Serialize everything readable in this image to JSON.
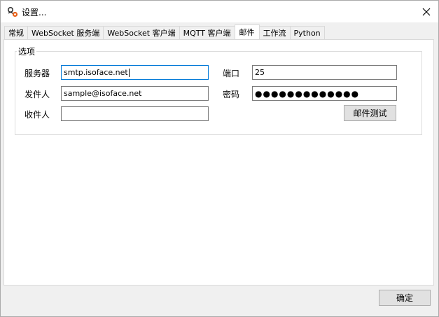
{
  "window": {
    "title": "设置..."
  },
  "tabs": [
    {
      "label": "常规"
    },
    {
      "label": "WebSocket 服务端"
    },
    {
      "label": "WebSocket 客户端"
    },
    {
      "label": "MQTT 客户端"
    },
    {
      "label": "邮件",
      "active": true
    },
    {
      "label": "工作流"
    },
    {
      "label": "Python"
    }
  ],
  "options": {
    "legend": "选项",
    "server_label": "服务器",
    "server_value": "smtp.isoface.net",
    "port_label": "端口",
    "port_value": "25",
    "sender_label": "发件人",
    "sender_value": "sample@isoface.net",
    "password_label": "密码",
    "password_mask": "●●●●●●●●●●●●●",
    "recipient_label": "收件人",
    "recipient_value": "",
    "test_button": "邮件测试"
  },
  "footer": {
    "ok_button": "确定"
  },
  "icons": {
    "app": "gear-app-icon",
    "close": "close-icon"
  }
}
